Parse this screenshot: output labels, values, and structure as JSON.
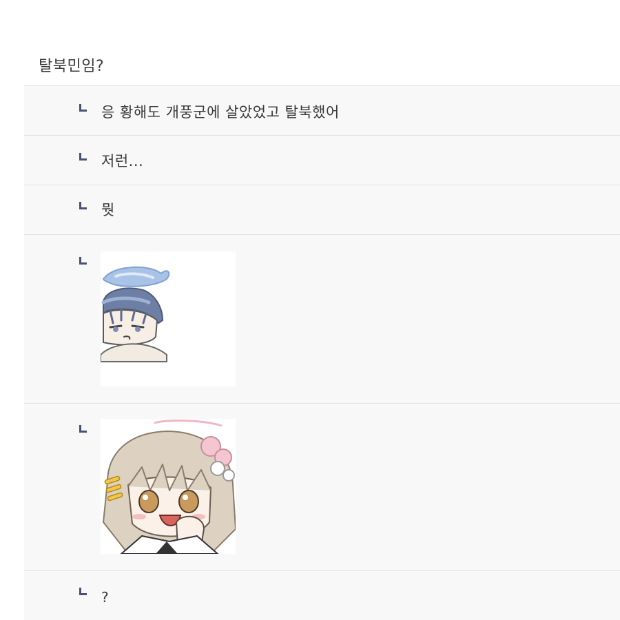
{
  "thread": {
    "top_comment": "탈북민임?",
    "replies": [
      {
        "text": "응 황해도 개풍군에 살았었고 탈북했어"
      },
      {
        "text": "저런..."
      },
      {
        "text": "뭣"
      },
      {
        "sticker": "sticker-blue-halo-girl"
      },
      {
        "sticker": "sticker-pink-flower-girl"
      },
      {
        "text": "?"
      }
    ]
  },
  "colors": {
    "reply_background": "#f8f8f8",
    "divider": "#e2e2e2",
    "reply_arrow": "#4a5173",
    "text": "#3a3a3a"
  }
}
